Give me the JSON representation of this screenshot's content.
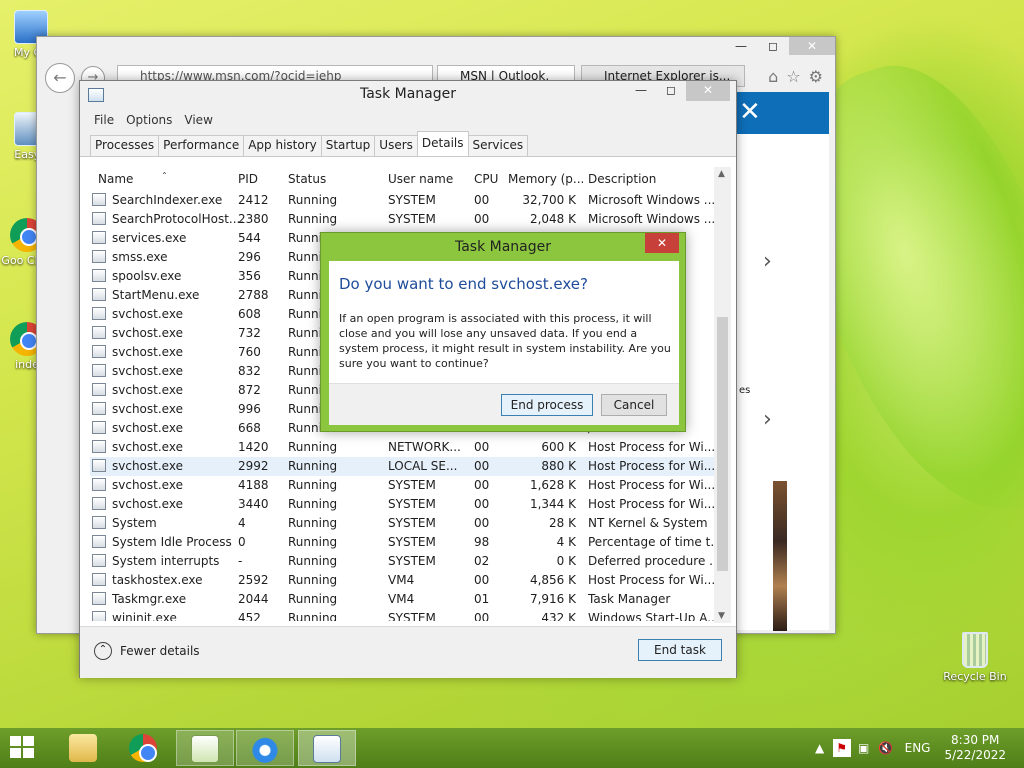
{
  "desktop": {
    "icons": [
      {
        "label": "My Co",
        "name": "my-computer"
      },
      {
        "label": "EasyB",
        "name": "easybcd"
      },
      {
        "label": "Goo Chro",
        "name": "google-chrome"
      },
      {
        "label": "inde",
        "name": "index-shortcut"
      }
    ],
    "recycle_bin": "Recycle Bin"
  },
  "ie": {
    "address": "https://www.msn.com/?ocid=iehp",
    "tabs": [
      "MSN | Outlook,",
      "Internet Explorer is..."
    ],
    "right_text": "es"
  },
  "task_manager": {
    "title": "Task Manager",
    "menu": [
      "File",
      "Options",
      "View"
    ],
    "tabs": [
      "Processes",
      "Performance",
      "App history",
      "Startup",
      "Users",
      "Details",
      "Services"
    ],
    "active_tab": "Details",
    "columns": [
      "Name",
      "PID",
      "Status",
      "User name",
      "CPU",
      "Memory (p...",
      "Description"
    ],
    "rows": [
      {
        "name": "SearchIndexer.exe",
        "pid": "2412",
        "status": "Running",
        "user": "SYSTEM",
        "cpu": "00",
        "mem": "32,700 K",
        "desc": "Microsoft Windows ..."
      },
      {
        "name": "SearchProtocolHost....",
        "pid": "2380",
        "status": "Running",
        "user": "SYSTEM",
        "cpu": "00",
        "mem": "2,048 K",
        "desc": "Microsoft Windows ..."
      },
      {
        "name": "services.exe",
        "pid": "544",
        "status": "Runnin",
        "user": "",
        "cpu": "",
        "mem": "",
        "desc": "ol..."
      },
      {
        "name": "smss.exe",
        "pid": "296",
        "status": "Runnin",
        "user": "",
        "cpu": "",
        "mem": "",
        "desc": "M..."
      },
      {
        "name": "spoolsv.exe",
        "pid": "356",
        "status": "Runnin",
        "user": "",
        "cpu": "",
        "mem": "",
        "desc": ""
      },
      {
        "name": "StartMenu.exe",
        "pid": "2788",
        "status": "Runnin",
        "user": "",
        "cpu": "",
        "mem": "",
        "desc": ""
      },
      {
        "name": "svchost.exe",
        "pid": "608",
        "status": "Runnin",
        "user": "",
        "cpu": "",
        "mem": "",
        "desc": "/i..."
      },
      {
        "name": "svchost.exe",
        "pid": "732",
        "status": "Runnin",
        "user": "",
        "cpu": "",
        "mem": "",
        "desc": "/i..."
      },
      {
        "name": "svchost.exe",
        "pid": "760",
        "status": "Runnin",
        "user": "",
        "cpu": "",
        "mem": "",
        "desc": "/i..."
      },
      {
        "name": "svchost.exe",
        "pid": "832",
        "status": "Runnin",
        "user": "",
        "cpu": "",
        "mem": "",
        "desc": "/i..."
      },
      {
        "name": "svchost.exe",
        "pid": "872",
        "status": "Runnin",
        "user": "",
        "cpu": "",
        "mem": "",
        "desc": "/i..."
      },
      {
        "name": "svchost.exe",
        "pid": "996",
        "status": "Runnin",
        "user": "",
        "cpu": "",
        "mem": "",
        "desc": "/i..."
      },
      {
        "name": "svchost.exe",
        "pid": "668",
        "status": "Runnin",
        "user": "",
        "cpu": "",
        "mem": "",
        "desc": "/i..."
      },
      {
        "name": "svchost.exe",
        "pid": "1420",
        "status": "Running",
        "user": "NETWORK...",
        "cpu": "00",
        "mem": "600 K",
        "desc": "Host Process for Wi..."
      },
      {
        "name": "svchost.exe",
        "pid": "2992",
        "status": "Running",
        "user": "LOCAL SE...",
        "cpu": "00",
        "mem": "880 K",
        "desc": "Host Process for Wi..."
      },
      {
        "name": "svchost.exe",
        "pid": "4188",
        "status": "Running",
        "user": "SYSTEM",
        "cpu": "00",
        "mem": "1,628 K",
        "desc": "Host Process for Wi..."
      },
      {
        "name": "svchost.exe",
        "pid": "3440",
        "status": "Running",
        "user": "SYSTEM",
        "cpu": "00",
        "mem": "1,344 K",
        "desc": "Host Process for Wi..."
      },
      {
        "name": "System",
        "pid": "4",
        "status": "Running",
        "user": "SYSTEM",
        "cpu": "00",
        "mem": "28 K",
        "desc": "NT Kernel & System"
      },
      {
        "name": "System Idle Process",
        "pid": "0",
        "status": "Running",
        "user": "SYSTEM",
        "cpu": "98",
        "mem": "4 K",
        "desc": "Percentage of time t..."
      },
      {
        "name": "System interrupts",
        "pid": "-",
        "status": "Running",
        "user": "SYSTEM",
        "cpu": "02",
        "mem": "0 K",
        "desc": "Deferred procedure ..."
      },
      {
        "name": "taskhostex.exe",
        "pid": "2592",
        "status": "Running",
        "user": "VM4",
        "cpu": "00",
        "mem": "4,856 K",
        "desc": "Host Process for Wi..."
      },
      {
        "name": "Taskmgr.exe",
        "pid": "2044",
        "status": "Running",
        "user": "VM4",
        "cpu": "01",
        "mem": "7,916 K",
        "desc": "Task Manager"
      },
      {
        "name": "wininit.exe",
        "pid": "452",
        "status": "Running",
        "user": "SYSTEM",
        "cpu": "00",
        "mem": "432 K",
        "desc": "Windows Start-Up A..."
      }
    ],
    "footer": {
      "fewer_details": "Fewer details",
      "end_task": "End task"
    }
  },
  "dialog": {
    "title": "Task Manager",
    "heading": "Do you want to end svchost.exe?",
    "body": "If an open program is associated with this process, it will close and you will lose any unsaved data. If you end a system process, it might result in system instability. Are you sure you want to continue?",
    "primary": "End process",
    "cancel": "Cancel"
  },
  "taskbar": {
    "language": "ENG",
    "time": "8:30 PM",
    "date": "5/22/2022"
  },
  "colors": {
    "accent_blue": "#0e6eb8",
    "dialog_frame": "#8cc63e",
    "close_red": "#c7413a",
    "heading_blue": "#1e4c9a"
  }
}
